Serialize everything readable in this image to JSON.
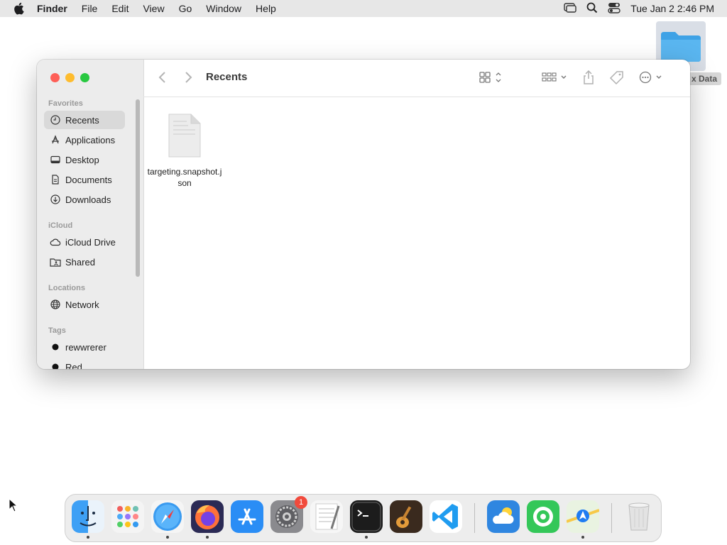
{
  "menubar": {
    "apple_icon": "apple-logo-icon",
    "app_name": "Finder",
    "menus": [
      "File",
      "Edit",
      "View",
      "Go",
      "Window",
      "Help"
    ],
    "clock": "Tue Jan 2  2:46 PM"
  },
  "desktop": {
    "folder_label": "x Data"
  },
  "window": {
    "title": "Recents",
    "sidebar": {
      "sections": {
        "favorites": "Favorites",
        "icloud": "iCloud",
        "locations": "Locations",
        "tags": "Tags"
      },
      "favorites": [
        {
          "label": "Recents",
          "icon": "clock-icon",
          "active": true
        },
        {
          "label": "Applications",
          "icon": "applications-icon"
        },
        {
          "label": "Desktop",
          "icon": "desktop-icon"
        },
        {
          "label": "Documents",
          "icon": "document-icon"
        },
        {
          "label": "Downloads",
          "icon": "download-icon"
        }
      ],
      "icloud": [
        {
          "label": "iCloud Drive",
          "icon": "cloud-icon"
        },
        {
          "label": "Shared",
          "icon": "shared-folder-icon"
        }
      ],
      "locations": [
        {
          "label": "Network",
          "icon": "globe-icon"
        }
      ],
      "tags": [
        {
          "label": "rewwrerer",
          "color": "#111111"
        },
        {
          "label": "Red",
          "color": "#111111"
        }
      ]
    },
    "files": [
      {
        "name": "targeting.snapshot.json",
        "icon": "json-file-icon"
      }
    ]
  },
  "dock": {
    "apps": [
      "Finder",
      "Launchpad",
      "Safari",
      "Firefox",
      "App Store",
      "System Settings",
      "TextEdit",
      "Terminal",
      "GarageBand",
      "Visual Studio Code",
      "Weather",
      "Find My",
      "Maps",
      "Trash"
    ],
    "settings_badge": "1"
  }
}
